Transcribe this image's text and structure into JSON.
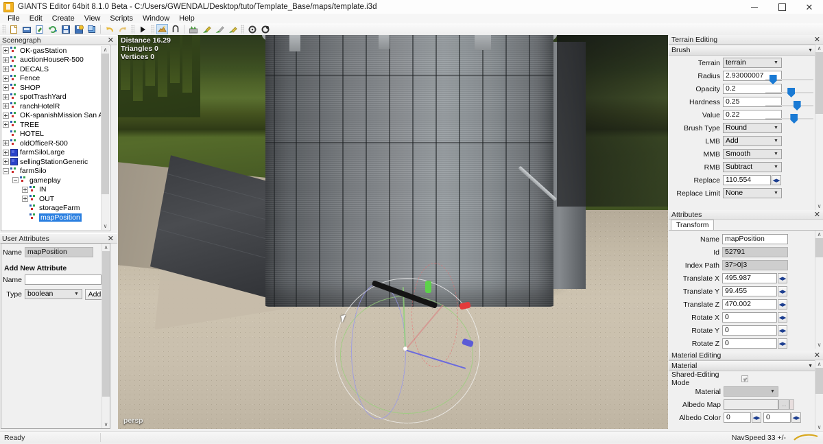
{
  "window": {
    "title": "GIANTS Editor 64bit 8.1.0 Beta - C:/Users/GWENDAL/Desktop/tuto/Template_Base/maps/template.i3d",
    "app_icon": "giants-editor-icon",
    "minimize": "–",
    "maximize": "❐",
    "close": "✕"
  },
  "menubar": {
    "items": [
      {
        "label": "File"
      },
      {
        "label": "Edit"
      },
      {
        "label": "Create"
      },
      {
        "label": "View"
      },
      {
        "label": "Scripts"
      },
      {
        "label": "Window"
      },
      {
        "label": "Help"
      }
    ]
  },
  "toolbar": {
    "groups": [
      {
        "buttons": [
          {
            "name": "new-file-icon",
            "title": "New"
          },
          {
            "name": "open-file-icon",
            "title": "Open"
          },
          {
            "name": "import-file-icon",
            "title": "Import"
          },
          {
            "name": "reload-icon",
            "title": "Reload"
          },
          {
            "name": "save-icon",
            "title": "Save"
          },
          {
            "name": "save-as-icon",
            "title": "Save as"
          },
          {
            "name": "save-all-icon",
            "title": "Save all"
          },
          {
            "name": "undo-icon",
            "title": "Undo"
          },
          {
            "name": "redo-icon",
            "title": "Redo"
          }
        ]
      },
      {
        "buttons": [
          {
            "name": "play-icon",
            "title": "Play"
          }
        ]
      },
      {
        "buttons": [
          {
            "name": "terrain-edit-icon",
            "title": "Terrain editing",
            "active": true
          },
          {
            "name": "snap-icon",
            "title": "Snap"
          }
        ]
      },
      {
        "buttons": [
          {
            "name": "foliage-paint-icon",
            "title": "Paint foliage"
          },
          {
            "name": "terrain-paint-icon",
            "title": "Paint terrain"
          },
          {
            "name": "terrain-sculpt-icon",
            "title": "Sculpt terrain"
          },
          {
            "name": "terrain-detail-icon",
            "title": "Terrain detail"
          }
        ]
      },
      {
        "buttons": [
          {
            "name": "refresh-scene-icon",
            "title": "Refresh"
          },
          {
            "name": "settings-icon",
            "title": "Settings"
          }
        ]
      }
    ]
  },
  "scenegraph": {
    "title": "Scenegraph",
    "close": "✕",
    "scroll_up": "∧",
    "scroll_down": "∨",
    "nodes": [
      {
        "label": "OK-gasStation",
        "indent": 0,
        "expander": "plus",
        "icon": "transform-group-icon",
        "selected": false
      },
      {
        "label": "auctionHouseR-500",
        "indent": 0,
        "expander": "plus",
        "icon": "transform-group-icon",
        "selected": false
      },
      {
        "label": "DECALS",
        "indent": 0,
        "expander": "plus",
        "icon": "transform-group-icon",
        "selected": false
      },
      {
        "label": "Fence",
        "indent": 0,
        "expander": "plus",
        "icon": "transform-group-icon",
        "selected": false
      },
      {
        "label": "SHOP",
        "indent": 0,
        "expander": "plus",
        "icon": "transform-group-icon",
        "selected": false
      },
      {
        "label": "spotTrashYard",
        "indent": 0,
        "expander": "plus",
        "icon": "transform-group-icon",
        "selected": false
      },
      {
        "label": "ranchHotelR",
        "indent": 0,
        "expander": "plus",
        "icon": "transform-group-icon",
        "selected": false
      },
      {
        "label": "OK-spanishMission San Adar",
        "indent": 0,
        "expander": "plus",
        "icon": "transform-group-icon",
        "selected": false
      },
      {
        "label": "TREE",
        "indent": 0,
        "expander": "plus",
        "icon": "transform-group-icon",
        "selected": false
      },
      {
        "label": "HOTEL",
        "indent": 0,
        "expander": "none",
        "icon": "transform-group-icon",
        "selected": false
      },
      {
        "label": "oldOfficeR-500",
        "indent": 0,
        "expander": "plus",
        "icon": "transform-group-icon",
        "selected": false
      },
      {
        "label": "farmSiloLarge",
        "indent": 0,
        "expander": "plus",
        "icon": "mesh-icon",
        "selected": false
      },
      {
        "label": "sellingStationGeneric",
        "indent": 0,
        "expander": "plus",
        "icon": "mesh-icon",
        "selected": false
      },
      {
        "label": "farmSilo",
        "indent": 0,
        "expander": "minus",
        "icon": "transform-group-icon",
        "selected": false
      },
      {
        "label": "gameplay",
        "indent": 1,
        "expander": "minus",
        "icon": "transform-group-icon",
        "selected": false
      },
      {
        "label": "IN",
        "indent": 2,
        "expander": "plus",
        "icon": "transform-group-icon",
        "selected": false
      },
      {
        "label": "OUT",
        "indent": 2,
        "expander": "plus",
        "icon": "transform-group-icon",
        "selected": false
      },
      {
        "label": "storageFarm",
        "indent": 2,
        "expander": "none",
        "icon": "transform-group-icon",
        "selected": false
      },
      {
        "label": "mapPosition",
        "indent": 2,
        "expander": "none",
        "icon": "transform-group-icon",
        "selected": true
      }
    ]
  },
  "user_attributes": {
    "title": "User Attributes",
    "close": "✕",
    "name_label": "Name",
    "name_value": "mapPosition",
    "section_title": "Add New Attribute",
    "new_name_label": "Name",
    "new_name_value": "",
    "new_name_placeholder": "",
    "type_label": "Type",
    "type_value": "boolean",
    "add_button": "Add",
    "scroll_up": "∧",
    "scroll_down": "∨"
  },
  "viewport": {
    "distance": "Distance 16.29",
    "triangles": "Triangles 0",
    "vertices": "Vertices 0",
    "camera_label": "persp",
    "gizmo": "translate-rotate-gizmo"
  },
  "terrain_editing": {
    "title": "Terrain Editing",
    "close": "✕",
    "section": "Brush",
    "collapse_arrow": "▼",
    "scroll_up": "∧",
    "scroll_down": "∨",
    "fields": [
      {
        "label": "Terrain",
        "value": "terrain",
        "kind": "combo"
      },
      {
        "label": "Radius",
        "value": "2.93000007",
        "kind": "text"
      },
      {
        "label": "Opacity",
        "value": "0.2",
        "kind": "text"
      },
      {
        "label": "Hardness",
        "value": "0.25",
        "kind": "text"
      },
      {
        "label": "Value",
        "value": "0.22",
        "kind": "text"
      },
      {
        "label": "Brush Type",
        "value": "Round",
        "kind": "combo"
      },
      {
        "label": "LMB",
        "value": "Add",
        "kind": "combo"
      },
      {
        "label": "MMB",
        "value": "Smooth",
        "kind": "combo"
      },
      {
        "label": "RMB",
        "value": "Subtract",
        "kind": "combo"
      },
      {
        "label": "Replace",
        "value": "110.554",
        "kind": "spin"
      },
      {
        "label": "Replace Limit",
        "value": "None",
        "kind": "combo"
      }
    ],
    "sliders": [
      {
        "name": "radius-slider",
        "pos": 8
      },
      {
        "name": "opacity-slider",
        "pos": 46
      },
      {
        "name": "hardness-slider",
        "pos": 58
      },
      {
        "name": "value-slider",
        "pos": 52
      }
    ],
    "accent": "#1a7ad4"
  },
  "attributes": {
    "title": "Attributes",
    "close": "✕",
    "tabs": [
      {
        "label": "Transform",
        "active": true
      }
    ],
    "scroll_up": "∧",
    "scroll_down": "∨",
    "fields": [
      {
        "label": "Name",
        "value": "mapPosition",
        "kind": "text",
        "readonly": false
      },
      {
        "label": "Id",
        "value": "52791",
        "kind": "text",
        "readonly": true
      },
      {
        "label": "Index Path",
        "value": "37>0|3",
        "kind": "text",
        "readonly": true
      },
      {
        "label": "Translate X",
        "value": "495.987",
        "kind": "spin",
        "readonly": false
      },
      {
        "label": "Translate Y",
        "value": "99.455",
        "kind": "spin",
        "readonly": false
      },
      {
        "label": "Translate Z",
        "value": "470.002",
        "kind": "spin",
        "readonly": false
      },
      {
        "label": "Rotate X",
        "value": "0",
        "kind": "spin",
        "readonly": false
      },
      {
        "label": "Rotate Y",
        "value": "0",
        "kind": "spin",
        "readonly": false
      },
      {
        "label": "Rotate Z",
        "value": "0",
        "kind": "spin",
        "readonly": false
      }
    ]
  },
  "material_editing": {
    "title": "Material Editing",
    "close": "✕",
    "section": "Material",
    "collapse_arrow": "▼",
    "scroll_up": "∧",
    "scroll_down": "∨",
    "shared_editing_label": "Shared-Editing Mode",
    "shared_editing_checked": true,
    "material_label": "Material",
    "material_value": "",
    "albedo_map_label": "Albedo Map",
    "albedo_map_value": "",
    "albedo_map_button": "...",
    "albedo_color_label": "Albedo Color",
    "albedo_color_1": "0",
    "albedo_color_2": "0"
  },
  "statusbar": {
    "status": "Ready",
    "navspeed": "NavSpeed 33 +/-",
    "logo": "giants-swoosh-logo"
  }
}
